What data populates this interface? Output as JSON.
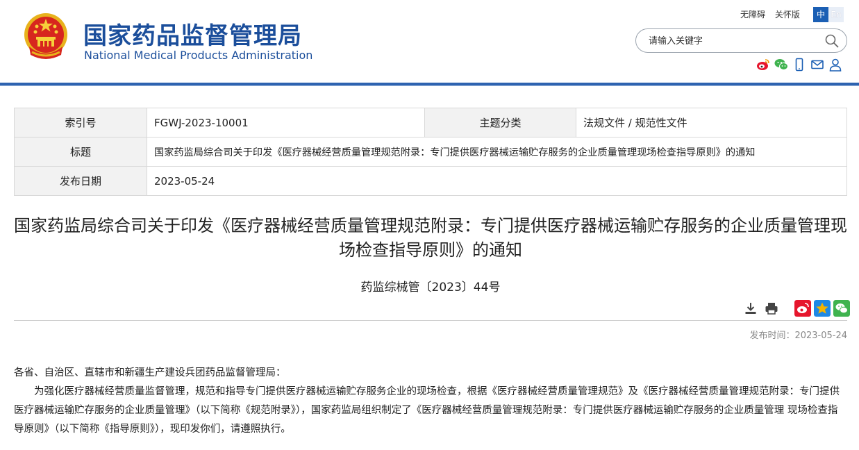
{
  "header": {
    "title_cn": "国家药品监督管理局",
    "title_en": "National Medical Products Administration",
    "accessibility": "无障碍",
    "care_mode": "关怀版",
    "lang_zh": "中",
    "lang_en": "En",
    "search_placeholder": "请输入关键字",
    "social_icons": [
      "weibo-icon",
      "wechat-icon",
      "mobile-icon",
      "mail-icon",
      "user-icon"
    ]
  },
  "info_table": {
    "index_label": "索引号",
    "index_value": "FGWJ-2023-10001",
    "category_label": "主题分类",
    "category_value": "法规文件 / 规范性文件",
    "title_label": "标题",
    "title_value": "国家药监局综合司关于印发《医疗器械经营质量管理规范附录：专门提供医疗器械运输贮存服务的企业质量管理现场检查指导原则》的通知",
    "date_label": "发布日期",
    "date_value": "2023-05-24"
  },
  "article": {
    "title": "国家药监局综合司关于印发《医疗器械经营质量管理规范附录：专门提供医疗器械运输贮存服务的企业质量管理现场检查指导原则》的通知",
    "doc_number": "药监综械管〔2023〕44号",
    "publish_time": "发布时间：2023-05-24",
    "salutation": "各省、自治区、直辖市和新疆生产建设兵团药品监督管理局：",
    "paragraph1": "为强化医疗器械经营质量监督管理，规范和指导专门提供医疗器械运输贮存服务企业的现场检查，根据《医疗器械经营质量管理规范》及《医疗器械经营质量管理规范附录：专门提供医疗器械运输贮存服务的企业质量管理》（以下简称《规范附录》），国家药监局组织制定了《医疗器械经营质量管理规范附录：专门提供医疗器械运输贮存服务的企业质量管理 现场检查指导原则》（以下简称《指导原则》），现印发你们，请遵照执行。"
  },
  "colors": {
    "brand_blue": "#1b4e9b",
    "header_bar": "#2e63b0",
    "weibo_red": "#e6162d",
    "qzone_gold": "#f5b400",
    "wechat_green": "#3fb34f"
  }
}
